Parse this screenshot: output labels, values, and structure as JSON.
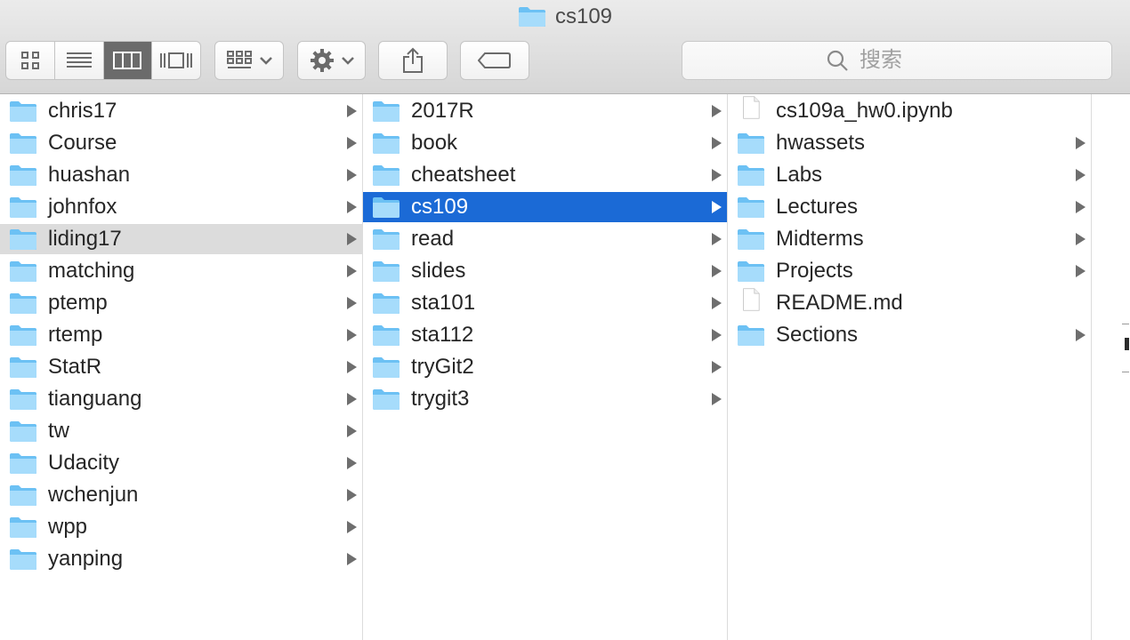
{
  "window": {
    "title": "cs109"
  },
  "toolbar": {
    "view_modes": [
      {
        "name": "icon-view",
        "icon": "grid-icon"
      },
      {
        "name": "list-view",
        "icon": "list-icon"
      },
      {
        "name": "column-view",
        "icon": "columns-icon",
        "active": true
      },
      {
        "name": "cover-flow-view",
        "icon": "coverflow-icon"
      }
    ],
    "search_placeholder": "搜索"
  },
  "columns": [
    {
      "items": [
        {
          "label": "chris17",
          "type": "folder"
        },
        {
          "label": "Course",
          "type": "folder"
        },
        {
          "label": "huashan",
          "type": "folder"
        },
        {
          "label": "johnfox",
          "type": "folder"
        },
        {
          "label": "liding17",
          "type": "folder",
          "selected": "inactive"
        },
        {
          "label": "matching",
          "type": "folder"
        },
        {
          "label": "ptemp",
          "type": "folder"
        },
        {
          "label": "rtemp",
          "type": "folder"
        },
        {
          "label": "StatR",
          "type": "folder"
        },
        {
          "label": "tianguang",
          "type": "folder"
        },
        {
          "label": "tw",
          "type": "folder"
        },
        {
          "label": "Udacity",
          "type": "folder"
        },
        {
          "label": "wchenjun",
          "type": "folder"
        },
        {
          "label": "wpp",
          "type": "folder"
        },
        {
          "label": "yanping",
          "type": "folder"
        }
      ]
    },
    {
      "items": [
        {
          "label": "2017R",
          "type": "folder"
        },
        {
          "label": "book",
          "type": "folder"
        },
        {
          "label": "cheatsheet",
          "type": "folder"
        },
        {
          "label": "cs109",
          "type": "folder",
          "selected": "active"
        },
        {
          "label": "read",
          "type": "folder"
        },
        {
          "label": "slides",
          "type": "folder"
        },
        {
          "label": "sta101",
          "type": "folder"
        },
        {
          "label": "sta112",
          "type": "folder"
        },
        {
          "label": "tryGit2",
          "type": "folder"
        },
        {
          "label": "trygit3",
          "type": "folder"
        }
      ]
    },
    {
      "items": [
        {
          "label": "cs109a_hw0.ipynb",
          "type": "file"
        },
        {
          "label": "hwassets",
          "type": "folder"
        },
        {
          "label": "Labs",
          "type": "folder"
        },
        {
          "label": "Lectures",
          "type": "folder"
        },
        {
          "label": "Midterms",
          "type": "folder"
        },
        {
          "label": "Projects",
          "type": "folder"
        },
        {
          "label": "README.md",
          "type": "file"
        },
        {
          "label": "Sections",
          "type": "folder"
        }
      ]
    }
  ],
  "colors": {
    "folder_light": "#a6dcfb",
    "folder_dark": "#6cc1f4",
    "selection_active": "#1b6ad6",
    "selection_inactive": "#dcdcdc"
  }
}
